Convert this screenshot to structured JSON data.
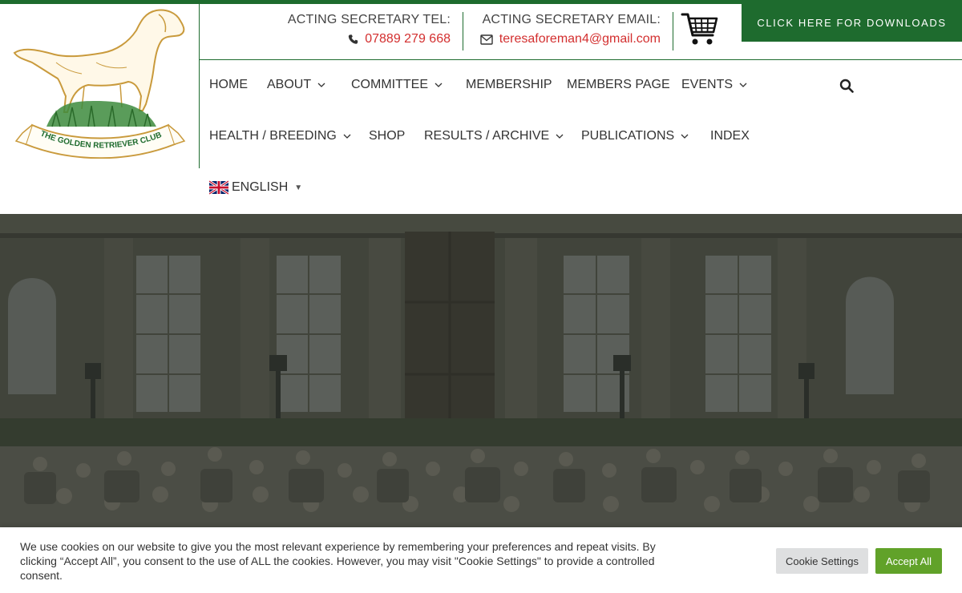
{
  "header": {
    "logo_text": "THE GOLDEN RETRIEVER CLUB",
    "tel_label": "ACTING SECRETARY TEL:",
    "tel_value": "07889 279 668",
    "email_label": "ACTING SECRETARY EMAIL:",
    "email_value": "teresaforeman4@gmail.com",
    "downloads_label": "CLICK HERE FOR DOWNLOADS"
  },
  "nav": {
    "items": [
      {
        "label": "HOME",
        "dropdown": false
      },
      {
        "label": "ABOUT",
        "dropdown": true
      },
      {
        "label": "COMMITTEE",
        "dropdown": true
      },
      {
        "label": "MEMBERSHIP",
        "dropdown": false
      },
      {
        "label": "MEMBERS PAGE",
        "dropdown": false
      },
      {
        "label": "EVENTS",
        "dropdown": true
      },
      {
        "label": "HEALTH / BREEDING",
        "dropdown": true
      },
      {
        "label": "SHOP",
        "dropdown": false
      },
      {
        "label": "RESULTS / ARCHIVE",
        "dropdown": true
      },
      {
        "label": "PUBLICATIONS",
        "dropdown": true
      },
      {
        "label": "INDEX",
        "dropdown": false
      }
    ],
    "language": "ENGLISH",
    "language_caret": "▼"
  },
  "cookie": {
    "text": "We use cookies on our website to give you the most relevant experience by remembering your preferences and repeat visits. By clicking “Accept All”, you consent to the use of ALL the cookies. However, you may visit \"Cookie Settings\" to provide a controlled consent.",
    "settings_label": "Cookie Settings",
    "accept_label": "Accept All"
  },
  "icons": {
    "phone": "phone-icon",
    "email": "envelope-icon",
    "cart": "shopping-cart-icon",
    "search": "search-icon",
    "flag": "uk-flag-icon",
    "chevron": "chevron-down-icon"
  },
  "colors": {
    "brand_green": "#1e6b2e",
    "contact_red": "#d32f2f",
    "accept_green": "#61a229",
    "logo_gold": "#c99a3c"
  }
}
